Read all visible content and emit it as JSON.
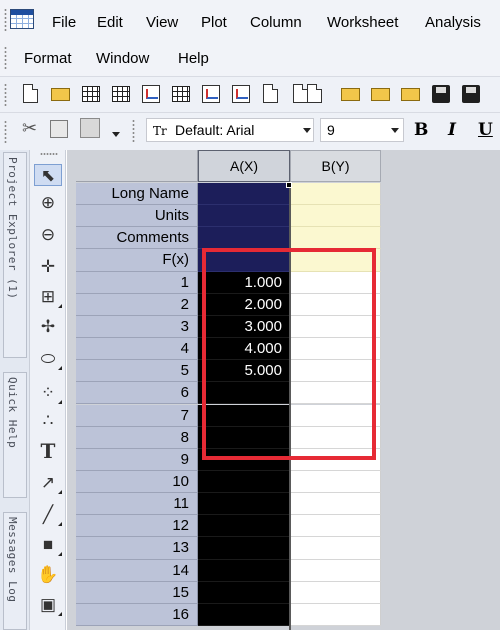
{
  "menu": {
    "row1": [
      "File",
      "Edit",
      "View",
      "Plot",
      "Column",
      "Worksheet",
      "Analysis"
    ],
    "row2": [
      "Format",
      "Window",
      "Help"
    ]
  },
  "format_toolbar": {
    "font_prefix": "Tr",
    "font": "Default: Arial",
    "size": "9",
    "bold": "B",
    "italic": "I",
    "underline": "U"
  },
  "side_tabs": [
    "Project Explorer (1)",
    "Quick Help",
    "Messages Log"
  ],
  "tools": [
    "pointer-tool",
    "zoom-in-tool",
    "zoom-out-tool",
    "data-reader-tool",
    "screen-reader-tool",
    "data-selector-tool",
    "region-mask-tool",
    "draw-data-tool",
    "text-tool",
    "arrow-tool",
    "line-tool",
    "rectangle-tool",
    "pan-tool",
    "insert-graph-tool"
  ],
  "text_tool_glyph": "T",
  "columns": [
    {
      "id": "A",
      "header": "A(X)"
    },
    {
      "id": "B",
      "header": "B(Y)"
    }
  ],
  "label_rows": [
    "Long Name",
    "Units",
    "Comments",
    "F(x)"
  ],
  "rows": [
    {
      "n": "1",
      "a": "1.000",
      "b": ""
    },
    {
      "n": "2",
      "a": "2.000",
      "b": ""
    },
    {
      "n": "3",
      "a": "3.000",
      "b": ""
    },
    {
      "n": "4",
      "a": "4.000",
      "b": ""
    },
    {
      "n": "5",
      "a": "5.000",
      "b": ""
    },
    {
      "n": "6",
      "a": "",
      "b": ""
    },
    {
      "n": "7",
      "a": "",
      "b": ""
    },
    {
      "n": "8",
      "a": "",
      "b": ""
    },
    {
      "n": "9",
      "a": "",
      "b": ""
    },
    {
      "n": "10",
      "a": "",
      "b": ""
    },
    {
      "n": "11",
      "a": "",
      "b": ""
    },
    {
      "n": "12",
      "a": "",
      "b": ""
    },
    {
      "n": "13",
      "a": "",
      "b": ""
    },
    {
      "n": "14",
      "a": "",
      "b": ""
    },
    {
      "n": "15",
      "a": "",
      "b": ""
    },
    {
      "n": "16",
      "a": "",
      "b": ""
    }
  ],
  "colors": {
    "highlight": "#e62a35",
    "selected_column": "#000000",
    "label_row_fill_a": "#1c1e5a",
    "label_row_fill_b": "#fbf8d0",
    "row_header": "#bcc3d8"
  }
}
